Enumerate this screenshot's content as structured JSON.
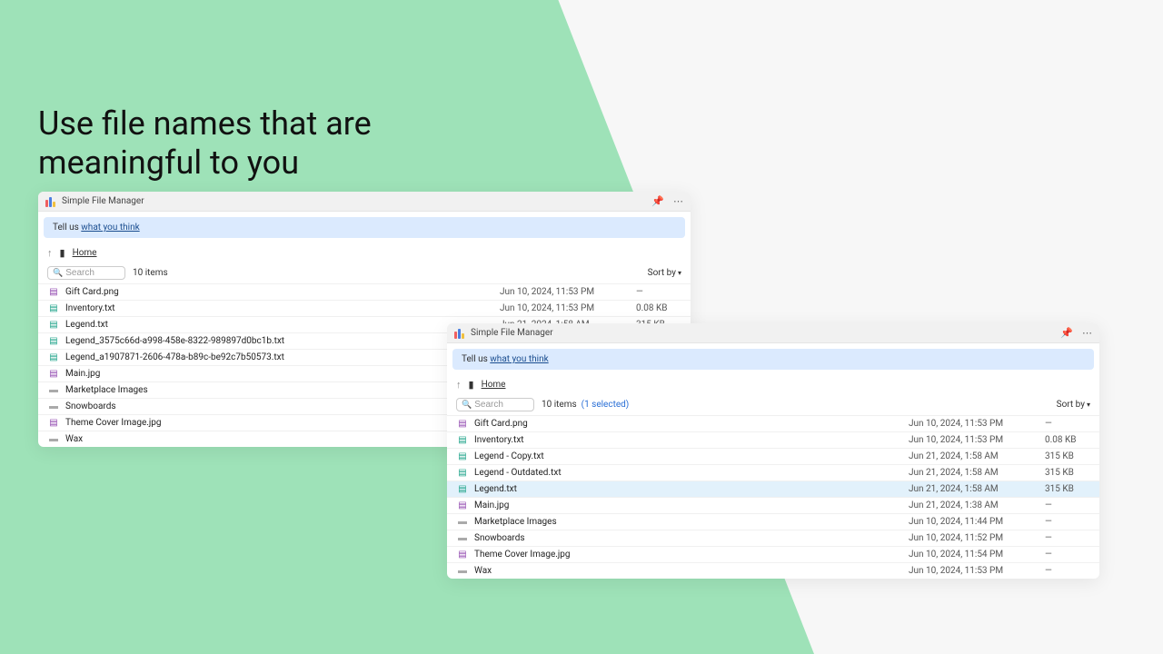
{
  "headline": "Use file names that are meaningful to you",
  "common": {
    "app_title": "Simple File Manager",
    "feedback_prefix": "Tell us ",
    "feedback_link": "what you think",
    "home_label": "Home",
    "search_placeholder": "Search",
    "sort_label": "Sort by"
  },
  "panelA": {
    "item_count": "10 items",
    "files": [
      {
        "icon": "img",
        "name": "Gift Card.png",
        "date": "Jun 10, 2024, 11:53 PM",
        "size": "—"
      },
      {
        "icon": "txt",
        "name": "Inventory.txt",
        "date": "Jun 10, 2024, 11:53 PM",
        "size": "0.08 KB"
      },
      {
        "icon": "txt",
        "name": "Legend.txt",
        "date": "Jun 21, 2024, 1:58 AM",
        "size": "315 KB"
      },
      {
        "icon": "txt",
        "name": "Legend_3575c66d-a998-458e-8322-989897d0bc1b.txt",
        "date": "",
        "size": ""
      },
      {
        "icon": "txt",
        "name": "Legend_a1907871-2606-478a-b89c-be92c7b50573.txt",
        "date": "",
        "size": ""
      },
      {
        "icon": "img",
        "name": "Main.jpg",
        "date": "",
        "size": ""
      },
      {
        "icon": "folder",
        "name": "Marketplace Images",
        "date": "",
        "size": ""
      },
      {
        "icon": "folder",
        "name": "Snowboards",
        "date": "",
        "size": ""
      },
      {
        "icon": "img",
        "name": "Theme Cover Image.jpg",
        "date": "",
        "size": ""
      },
      {
        "icon": "folder",
        "name": "Wax",
        "date": "",
        "size": ""
      }
    ]
  },
  "panelB": {
    "item_count": "10 items",
    "selected_count": "(1 selected)",
    "files": [
      {
        "icon": "img",
        "name": "Gift Card.png",
        "date": "Jun 10, 2024, 11:53 PM",
        "size": "—",
        "selected": false
      },
      {
        "icon": "txt",
        "name": "Inventory.txt",
        "date": "Jun 10, 2024, 11:53 PM",
        "size": "0.08 KB",
        "selected": false
      },
      {
        "icon": "txt",
        "name": "Legend - Copy.txt",
        "date": "Jun 21, 2024, 1:58 AM",
        "size": "315 KB",
        "selected": false
      },
      {
        "icon": "txt",
        "name": "Legend - Outdated.txt",
        "date": "Jun 21, 2024, 1:58 AM",
        "size": "315 KB",
        "selected": false
      },
      {
        "icon": "txt",
        "name": "Legend.txt",
        "date": "Jun 21, 2024, 1:58 AM",
        "size": "315 KB",
        "selected": true
      },
      {
        "icon": "img",
        "name": "Main.jpg",
        "date": "Jun 21, 2024, 1:38 AM",
        "size": "—",
        "selected": false
      },
      {
        "icon": "folder",
        "name": "Marketplace Images",
        "date": "Jun 10, 2024, 11:44 PM",
        "size": "—",
        "selected": false
      },
      {
        "icon": "folder",
        "name": "Snowboards",
        "date": "Jun 10, 2024, 11:52 PM",
        "size": "—",
        "selected": false
      },
      {
        "icon": "img",
        "name": "Theme Cover Image.jpg",
        "date": "Jun 10, 2024, 11:54 PM",
        "size": "—",
        "selected": false
      },
      {
        "icon": "folder",
        "name": "Wax",
        "date": "Jun 10, 2024, 11:53 PM",
        "size": "—",
        "selected": false
      }
    ]
  }
}
